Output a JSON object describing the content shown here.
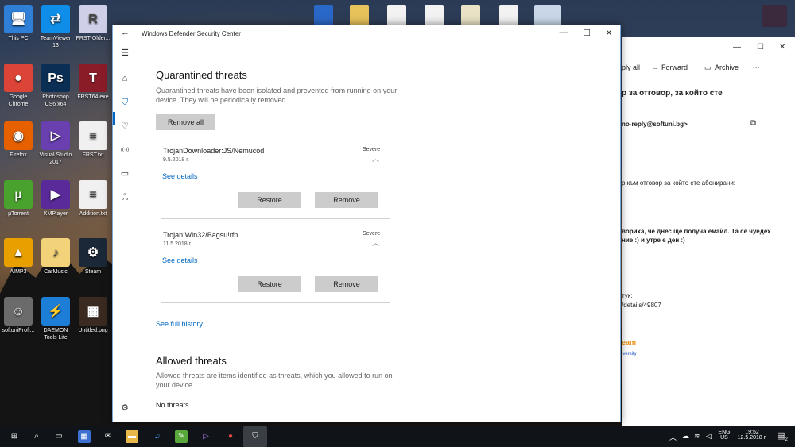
{
  "desktop": {
    "icons": [
      {
        "label": "This PC",
        "glyph": "🖥",
        "color": "#2f7fd6"
      },
      {
        "label": "TeamViewer 13",
        "glyph": "⇄",
        "color": "#0e8ee9"
      },
      {
        "label": "FRST-Older...",
        "glyph": "R",
        "color": "#cfcfe8"
      },
      {
        "label": "Google Chrome",
        "glyph": "●",
        "color": "#db4437"
      },
      {
        "label": "Photoshop CS6 x64",
        "glyph": "Ps",
        "color": "#0b2e55"
      },
      {
        "label": "FRST64.exe",
        "glyph": "T",
        "color": "#8a1c28"
      },
      {
        "label": "Firefox",
        "glyph": "◉",
        "color": "#e66000"
      },
      {
        "label": "Visual Studio 2017",
        "glyph": "▷",
        "color": "#6a3fb0"
      },
      {
        "label": "FRST.txt",
        "glyph": "≡",
        "color": "#f0f0f0"
      },
      {
        "label": "µTorrent",
        "glyph": "µ",
        "color": "#4aa22e"
      },
      {
        "label": "KMPlayer",
        "glyph": "▶",
        "color": "#5b2a9a"
      },
      {
        "label": "Addition.txt",
        "glyph": "≡",
        "color": "#f0f0f0"
      },
      {
        "label": "AIMP3",
        "glyph": "▲",
        "color": "#e8a000"
      },
      {
        "label": "CarMusic",
        "glyph": "♪",
        "color": "#f2d37a"
      },
      {
        "label": "Steam",
        "glyph": "⚙",
        "color": "#1b2838"
      },
      {
        "label": "softuniProfi...",
        "glyph": "☺",
        "color": "#6b6b6b"
      },
      {
        "label": "DAEMON Tools Lite",
        "glyph": "⚡",
        "color": "#1d7ed8"
      },
      {
        "label": "Untitled.png",
        "glyph": "▦",
        "color": "#3a2a20"
      }
    ]
  },
  "mail": {
    "reply_all": "ply all",
    "forward": "Forward",
    "archive": "Archive",
    "more": "···",
    "subject": "р за отговор, за който сте",
    "from": "no-reply@softuni.bg>",
    "line1": "р към отговор за който сте абонирани:",
    "line2": "вориха, че днес ще получа емайл. Та се чуедех",
    "line3": "ние :) и утре е ден :)",
    "line4": "тук:",
    "line5": "/details/49807",
    "team": "eam",
    "university": "iversity"
  },
  "window": {
    "title": "Windows Defender Security Center",
    "back_glyph": "←",
    "minimize": "—",
    "maximize": "☐",
    "close": "✕"
  },
  "nav_glyphs": {
    "menu": "☰",
    "home": "⌂",
    "shield": "⛉",
    "health": "♡",
    "firewall": "((·))",
    "app": "▭",
    "family": "ஃ",
    "settings": "⚙"
  },
  "quarantine": {
    "heading": "Quarantined threats",
    "description": "Quarantined threats have been isolated and prevented from running on your device.  They will be periodically removed.",
    "remove_all": "Remove all",
    "threats": [
      {
        "name": "TrojanDownloader:JS/Nemucod",
        "date": "9.5.2018 г.",
        "severity": "Severe",
        "see_details": "See details",
        "restore": "Restore",
        "remove": "Remove"
      },
      {
        "name": "Trojan:Win32/Bagsu!rfn",
        "date": "11.5.2018 г.",
        "severity": "Severe",
        "see_details": "See details",
        "restore": "Restore",
        "remove": "Remove"
      }
    ],
    "full_history": "See full history"
  },
  "allowed": {
    "heading": "Allowed threats",
    "description": "Allowed threats are items identified as threats, which you allowed to run on your device.",
    "none": "No threats."
  },
  "taskbar": {
    "lang": "ENG",
    "region": "US",
    "time": "19:52",
    "date": "12.5.2018 г.",
    "notif_count": "2"
  }
}
